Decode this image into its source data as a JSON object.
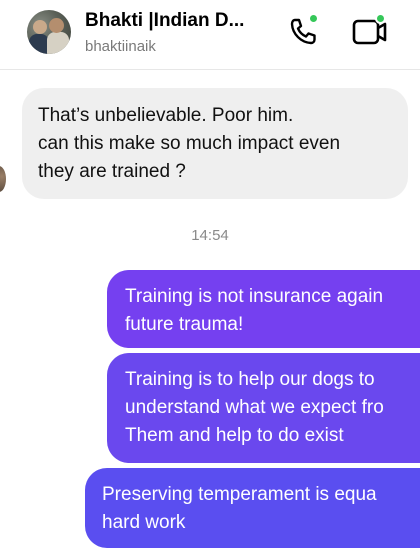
{
  "header": {
    "title": "Bhakti |Indian D...",
    "username": "bhaktiinaik",
    "call_icon": "phone-icon",
    "video_icon": "video-camera-icon",
    "online_color": "#35c759"
  },
  "incoming_message": {
    "lines": [
      "That’s unbelievable. Poor him.",
      "can this make so much impact even",
      "they are trained ?"
    ]
  },
  "timestamp": "14:54",
  "outgoing_messages": [
    {
      "lines": [
        "Training is not insurance again",
        "future trauma!"
      ],
      "color": "#7540f0"
    },
    {
      "lines": [
        "Training is to help our dogs to",
        "understand what we expect fro",
        "Them and help to do exist"
      ],
      "color": "#6a48ee"
    },
    {
      "lines": [
        "Preserving temperament is equa",
        "hard work"
      ],
      "color": "#5a4ef0"
    }
  ]
}
